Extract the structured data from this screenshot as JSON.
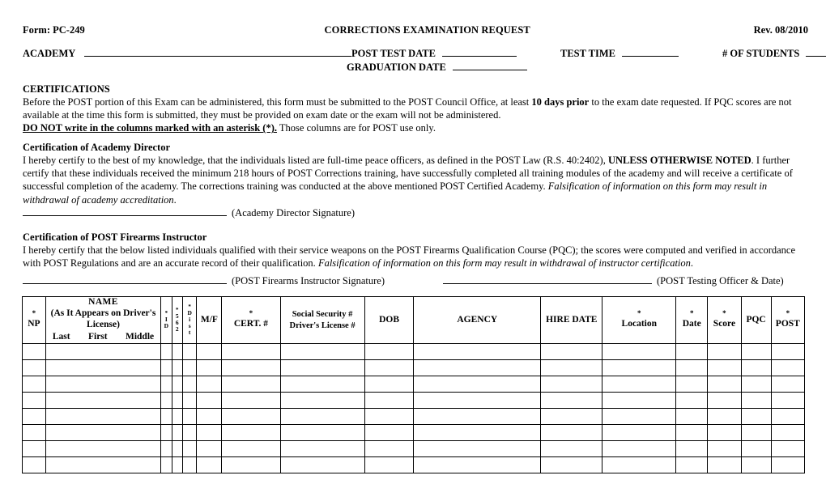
{
  "header": {
    "form_number": "Form: PC-249",
    "document_title": "CORRECTIONS EXAMINATION REQUEST",
    "revision": "Rev. 08/2010",
    "academy_label": "ACADEMY",
    "post_test_date_label": "POST TEST DATE",
    "graduation_date_label": "GRADUATION DATE",
    "test_time_label": "TEST TIME",
    "number_of_students_label": "# OF STUDENTS",
    "academy_value": "",
    "post_test_date_value": "",
    "graduation_date_value": "",
    "test_time_value": "",
    "number_of_students_value": ""
  },
  "certifications": {
    "heading": "CERTIFICATIONS",
    "line1_a": "Before the POST portion of this Exam can be administered, this form must be submitted to the POST Council Office, at least ",
    "line1_bold": "10 days prior",
    "line1_b": " to the exam date requested.  If PQC scores are not",
    "line2": "available at the time this form is submitted, they must be provided on exam date or the exam will not be administered.",
    "line3_bold_underline": "DO NOT write in the columns marked with an asterisk (*).",
    "line3_rest": "  Those columns are for POST use only."
  },
  "academy_director": {
    "heading": "Certification of Academy Director",
    "para_a": "I hereby certify to the best of my knowledge, that the individuals listed are full-time peace officers, as defined in the POST Law (R.S. 40:2402), ",
    "para_bold": "UNLESS OTHERWISE NOTED",
    "para_b": ".  I further certify that these individuals received the minimum 218 hours of POST Corrections training, have successfully completed all training modules of the academy and will receive a certificate of successful completion of the academy.    The corrections training was conducted at the above mentioned POST Certified Academy.   ",
    "para_italic": "Falsification of information on this form may result in withdrawal of academy accreditation",
    "para_c": ".",
    "signature_caption": "(Academy Director Signature)",
    "signature_value": ""
  },
  "firearms_instructor": {
    "heading": "Certification of POST Firearms Instructor",
    "para_a": "I hereby certify that the below listed individuals qualified with their service weapons on the POST Firearms Qualification Course (PQC); the scores were computed and verified in accordance with POST Regulations and are an accurate record of their qualification.  ",
    "para_italic": "Falsification of information on this form may result in withdrawal of instructor certification",
    "para_b": ".",
    "signature_caption": "(POST Firearms Instructor Signature)",
    "signature_value": "",
    "testing_officer_caption": "(POST Testing Officer & Date)",
    "testing_officer_value": ""
  },
  "roster_table": {
    "asterisk_glyph": "*",
    "columns": [
      {
        "key": "np",
        "label": "NP",
        "asterisk": true,
        "type": "simple"
      },
      {
        "key": "name",
        "label": "NAME",
        "asterisk": false,
        "type": "name",
        "sub": "(As It Appears on Driver's License)",
        "parts": [
          "Last",
          "First",
          "Middle"
        ]
      },
      {
        "key": "id",
        "label": "ID",
        "asterisk": true,
        "type": "vertical",
        "letters": [
          "I",
          "D"
        ]
      },
      {
        "key": "c562",
        "label": "562",
        "asterisk": true,
        "type": "vertical",
        "letters": [
          "5",
          "6",
          "2"
        ]
      },
      {
        "key": "dist",
        "label": "Dist",
        "asterisk": true,
        "type": "vertical",
        "letters": [
          "D",
          "i",
          "s",
          "t"
        ]
      },
      {
        "key": "mf",
        "label": "M/F",
        "asterisk": false,
        "type": "simple"
      },
      {
        "key": "cert",
        "label": "CERT. #",
        "asterisk": true,
        "type": "simple"
      },
      {
        "key": "ssn",
        "label": "Social Security #",
        "asterisk": false,
        "type": "two-line",
        "label2": "Driver's License #"
      },
      {
        "key": "dob",
        "label": "DOB",
        "asterisk": false,
        "type": "simple"
      },
      {
        "key": "agency",
        "label": "AGENCY",
        "asterisk": false,
        "type": "simple"
      },
      {
        "key": "hire",
        "label": "HIRE DATE",
        "asterisk": false,
        "type": "simple"
      },
      {
        "key": "loc",
        "label": "Location",
        "asterisk": true,
        "type": "simple"
      },
      {
        "key": "date",
        "label": "Date",
        "asterisk": true,
        "type": "simple"
      },
      {
        "key": "score",
        "label": "Score",
        "asterisk": true,
        "type": "simple"
      },
      {
        "key": "pqc",
        "label": "PQC",
        "asterisk": false,
        "type": "simple"
      },
      {
        "key": "post",
        "label": "POST",
        "asterisk": true,
        "type": "simple"
      }
    ],
    "row_count": 8,
    "rows": [
      {
        "np": "",
        "name": "",
        "id": "",
        "c562": "",
        "dist": "",
        "mf": "",
        "cert": "",
        "ssn": "",
        "dob": "",
        "agency": "",
        "hire": "",
        "loc": "",
        "date": "",
        "score": "",
        "post": ""
      },
      {
        "np": "",
        "name": "",
        "id": "",
        "c562": "",
        "dist": "",
        "mf": "",
        "cert": "",
        "ssn": "",
        "dob": "",
        "agency": "",
        "hire": "",
        "loc": "",
        "date": "",
        "score": "",
        "post": ""
      },
      {
        "np": "",
        "name": "",
        "id": "",
        "c562": "",
        "dist": "",
        "mf": "",
        "cert": "",
        "ssn": "",
        "dob": "",
        "agency": "",
        "hire": "",
        "loc": "",
        "date": "",
        "score": "",
        "post": ""
      },
      {
        "np": "",
        "name": "",
        "id": "",
        "c562": "",
        "dist": "",
        "mf": "",
        "cert": "",
        "ssn": "",
        "dob": "",
        "agency": "",
        "hire": "",
        "loc": "",
        "date": "",
        "score": "",
        "post": ""
      },
      {
        "np": "",
        "name": "",
        "id": "",
        "c562": "",
        "dist": "",
        "mf": "",
        "cert": "",
        "ssn": "",
        "dob": "",
        "agency": "",
        "hire": "",
        "loc": "",
        "date": "",
        "score": "",
        "post": ""
      },
      {
        "np": "",
        "name": "",
        "id": "",
        "c562": "",
        "dist": "",
        "mf": "",
        "cert": "",
        "ssn": "",
        "dob": "",
        "agency": "",
        "hire": "",
        "loc": "",
        "date": "",
        "score": "",
        "post": ""
      },
      {
        "np": "",
        "name": "",
        "id": "",
        "c562": "",
        "dist": "",
        "mf": "",
        "cert": "",
        "ssn": "",
        "dob": "",
        "agency": "",
        "hire": "",
        "loc": "",
        "date": "",
        "score": "",
        "post": ""
      },
      {
        "np": "",
        "name": "",
        "id": "",
        "c562": "",
        "dist": "",
        "mf": "",
        "cert": "",
        "ssn": "",
        "dob": "",
        "agency": "",
        "hire": "",
        "loc": "",
        "date": "",
        "score": "",
        "post": ""
      }
    ]
  },
  "colors": {
    "ink": "#000000",
    "paper": "#ffffff"
  }
}
